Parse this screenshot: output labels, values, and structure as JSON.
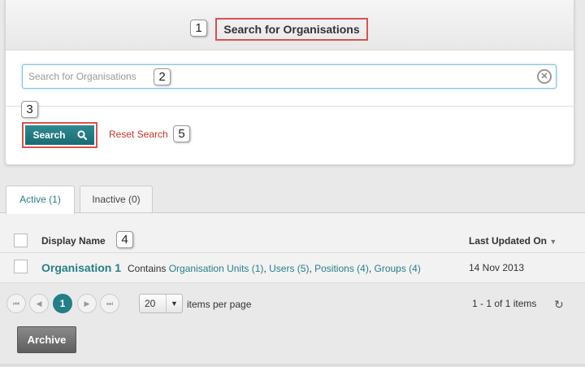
{
  "panel": {
    "title": "Search for Organisations",
    "search_placeholder": "Search for Organisations",
    "search_value": "",
    "clear_icon": "clear-icon",
    "search_label": "Search",
    "search_icon_name": "magnifier-icon",
    "reset_label": "Reset Search"
  },
  "callouts": [
    "1",
    "2",
    "3",
    "4",
    "5"
  ],
  "tabs": [
    {
      "label": "Active (1)",
      "active": true
    },
    {
      "label": "Inactive (0)",
      "active": false
    }
  ],
  "grid": {
    "columns": {
      "display_name": "Display Name",
      "last_updated": "Last Updated On",
      "sort": "▼"
    },
    "rows": [
      {
        "name": "Organisation 1",
        "contains": "Contains",
        "links": [
          "Organisation Units (1)",
          "Users (5)",
          "Positions (4)",
          "Groups (4)"
        ],
        "date": "14 Nov 2013"
      }
    ]
  },
  "pager": {
    "first": "⏮",
    "prev": "◀",
    "current": "1",
    "next": "▶",
    "last": "⏭",
    "page_size": "20",
    "page_size_arrow": "▼",
    "per_page_label": "items per page",
    "range": "1 - 1 of 1 items",
    "refresh": "↻"
  },
  "actions": {
    "archive": "Archive"
  },
  "colors": {
    "accent": "#237e87",
    "highlight": "#d9534f",
    "link_red": "#c9302c"
  }
}
